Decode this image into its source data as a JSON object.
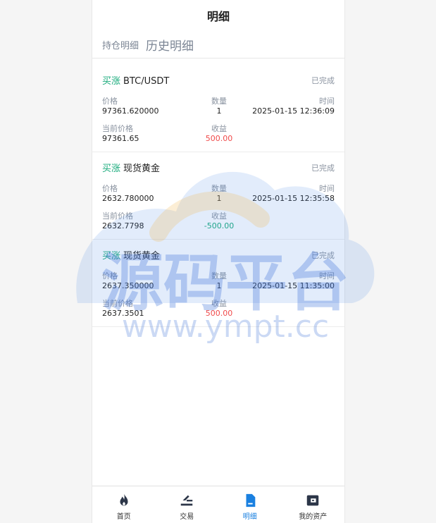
{
  "header": {
    "title": "明细"
  },
  "subtabs": [
    {
      "label": "持仓明细"
    },
    {
      "label": "历史明细"
    }
  ],
  "labels": {
    "price": "价格",
    "quantity": "数量",
    "time": "时间",
    "current_price": "当前价格",
    "profit": "收益"
  },
  "records": [
    {
      "direction": "买涨",
      "asset": "BTC/USDT",
      "status": "已完成",
      "price": "97361.620000",
      "quantity": "1",
      "time": "2025-01-15 12:36:09",
      "current_price": "97361.65",
      "profit": "500.00"
    },
    {
      "direction": "买涨",
      "asset": "现货黄金",
      "status": "已完成",
      "price": "2632.780000",
      "quantity": "1",
      "time": "2025-01-15 12:35:58",
      "current_price": "2632.7798",
      "profit": "-500.00"
    },
    {
      "direction": "买涨",
      "asset": "现货黄金",
      "status": "已完成",
      "price": "2637.350000",
      "quantity": "1",
      "time": "2025-01-15 11:35:00",
      "current_price": "2637.3501",
      "profit": "500.00"
    }
  ],
  "watermark": {
    "title": "源码平台",
    "url": "www.ympt.cc"
  },
  "nav": [
    {
      "label": "首页",
      "icon": "flame-icon"
    },
    {
      "label": "交易",
      "icon": "trade-icon"
    },
    {
      "label": "明细",
      "icon": "document-icon"
    },
    {
      "label": "我的资产",
      "icon": "wallet-icon"
    }
  ],
  "colors": {
    "up": "#1aab7c",
    "profit_positive": "#f04a4a",
    "profit_negative": "#1aab7c",
    "nav_active": "#1a80e0"
  }
}
